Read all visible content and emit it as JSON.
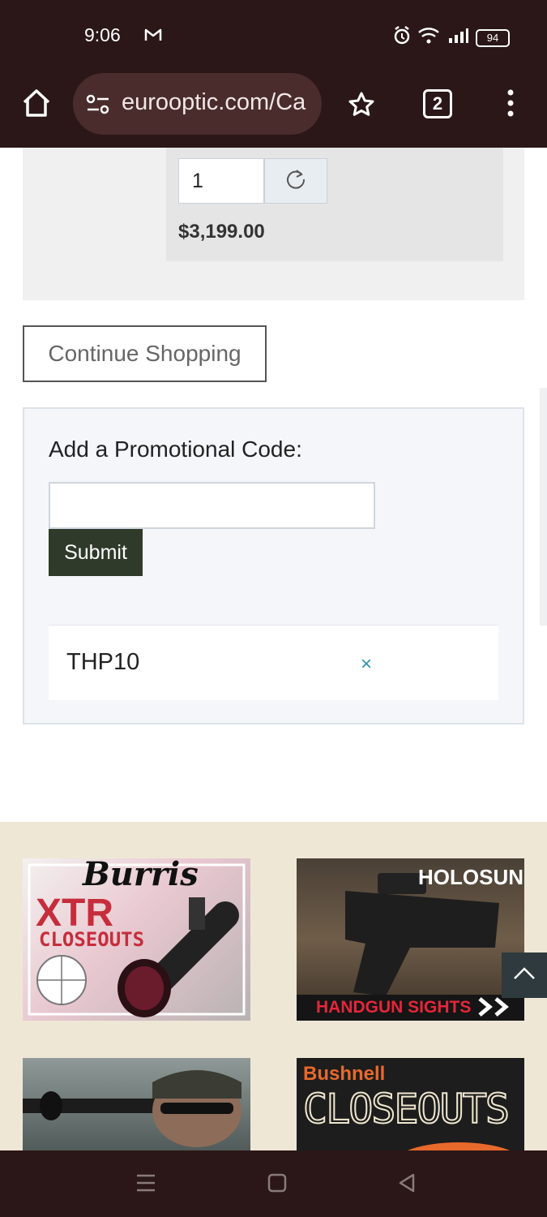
{
  "status_bar": {
    "time": "9:06",
    "battery": "94"
  },
  "browser": {
    "url": "eurooptic.com/Ca",
    "tab_count": "2"
  },
  "cart": {
    "quantity": "1",
    "price": "$3,199.00"
  },
  "continue_shopping_label": "Continue Shopping",
  "promo": {
    "title": "Add a Promotional Code:",
    "input_value": "",
    "submit_label": "Submit",
    "applied_code": "THP10",
    "remove_symbol": "×"
  },
  "ads": {
    "burris": {
      "brand": "Burris",
      "line1": "XTR",
      "line2": "CLOSEOUTS"
    },
    "holosun": {
      "brand": "HOLOSUN",
      "caption": "HANDGUN SIGHTS"
    },
    "bushnell": {
      "brand": "Bushnell",
      "caption": "CLOSEOUTS"
    }
  },
  "colors": {
    "chrome": "#2b1717",
    "submit_bg": "#2f3a2a",
    "remove_x": "#2a8fb0",
    "ads_bg": "#efe7d6"
  }
}
